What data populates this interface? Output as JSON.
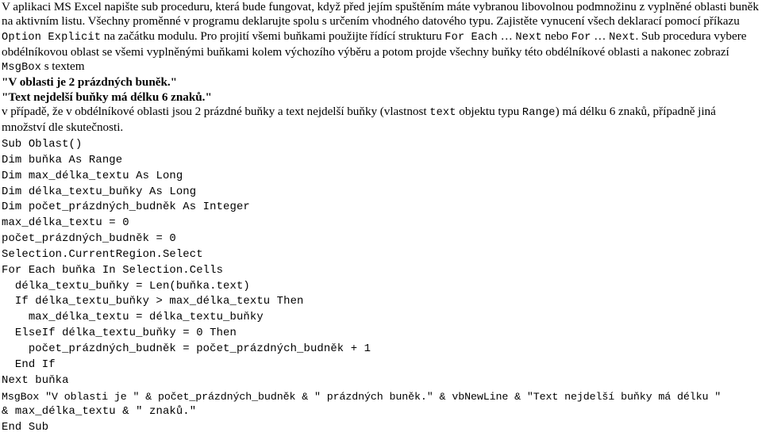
{
  "document": {
    "intro_paragraph": {
      "segments": [
        {
          "type": "text",
          "value": "V aplikaci MS Excel napište sub proceduru, která bude fungovat, když před jejím spuštěním máte vybranou libovolnou podmnožinu z vyplněné oblasti buněk na aktivním listu. Všechny proměnné v programu deklarujte spolu s určením vhodného datového typu. Zajistěte vynucení všech deklarací pomocí příkazu "
        },
        {
          "type": "code",
          "value": "Option Explicit"
        },
        {
          "type": "text",
          "value": " na začátku modulu. Pro projití všemi buňkami použijte řídící strukturu "
        },
        {
          "type": "code",
          "value": "For Each"
        },
        {
          "type": "text",
          "value": " … "
        },
        {
          "type": "code",
          "value": "Next"
        },
        {
          "type": "text",
          "value": " nebo "
        },
        {
          "type": "code",
          "value": "For"
        },
        {
          "type": "text",
          "value": " … "
        },
        {
          "type": "code",
          "value": "Next"
        },
        {
          "type": "text",
          "value": ". Sub procedura vybere obdélníkovou oblast se všemi vyplněnými buňkami kolem výchozího výběru a potom projde všechny buňky této obdélníkové oblasti a nakonec zobrazí "
        },
        {
          "type": "code",
          "value": "MsgBox"
        },
        {
          "type": "text",
          "value": " s textem"
        }
      ]
    },
    "quoted_lines": [
      "\"V oblasti je 2 prázdných buněk.\"",
      "\"Text nejdelší buňky má délku 6 znaků.\""
    ],
    "closing_paragraph": {
      "segments": [
        {
          "type": "text",
          "value": "v případě, že v obdélníkové oblasti jsou 2 prázdné buňky a text nejdelší buňky (vlastnost "
        },
        {
          "type": "code",
          "value": "text"
        },
        {
          "type": "text",
          "value": " objektu typu "
        },
        {
          "type": "code",
          "value": "Range"
        },
        {
          "type": "text",
          "value": ") má délku 6 znaků, případně jiná množství dle skutečnosti."
        }
      ]
    },
    "code": {
      "language": "VBA",
      "lines": [
        "Sub Oblast()",
        "Dim buňka As Range",
        "Dim max_délka_textu As Long",
        "Dim délka_textu_buňky As Long",
        "Dim počet_prázdných_budněk As Integer",
        "max_délka_textu = 0",
        "počet_prázdných_budněk = 0",
        "Selection.CurrentRegion.Select",
        "For Each buňka In Selection.Cells",
        "  délka_textu_buňky = Len(buňka.text)",
        "  If délka_textu_buňky > max_délka_textu Then",
        "    max_délka_textu = délka_textu_buňky",
        "  ElseIf délka_textu_buňky = 0 Then",
        "    počet_prázdných_budněk = počet_prázdných_budněk + 1",
        "  End If",
        "Next buňka",
        "MsgBox \"V oblasti je \" & počet_prázdných_budněk & \" prázdných buněk.\" & vbNewLine & \"Text nejdelší buňky má délku \"",
        "& max_délka_textu & \" znaků.\"",
        "End Sub"
      ]
    }
  }
}
